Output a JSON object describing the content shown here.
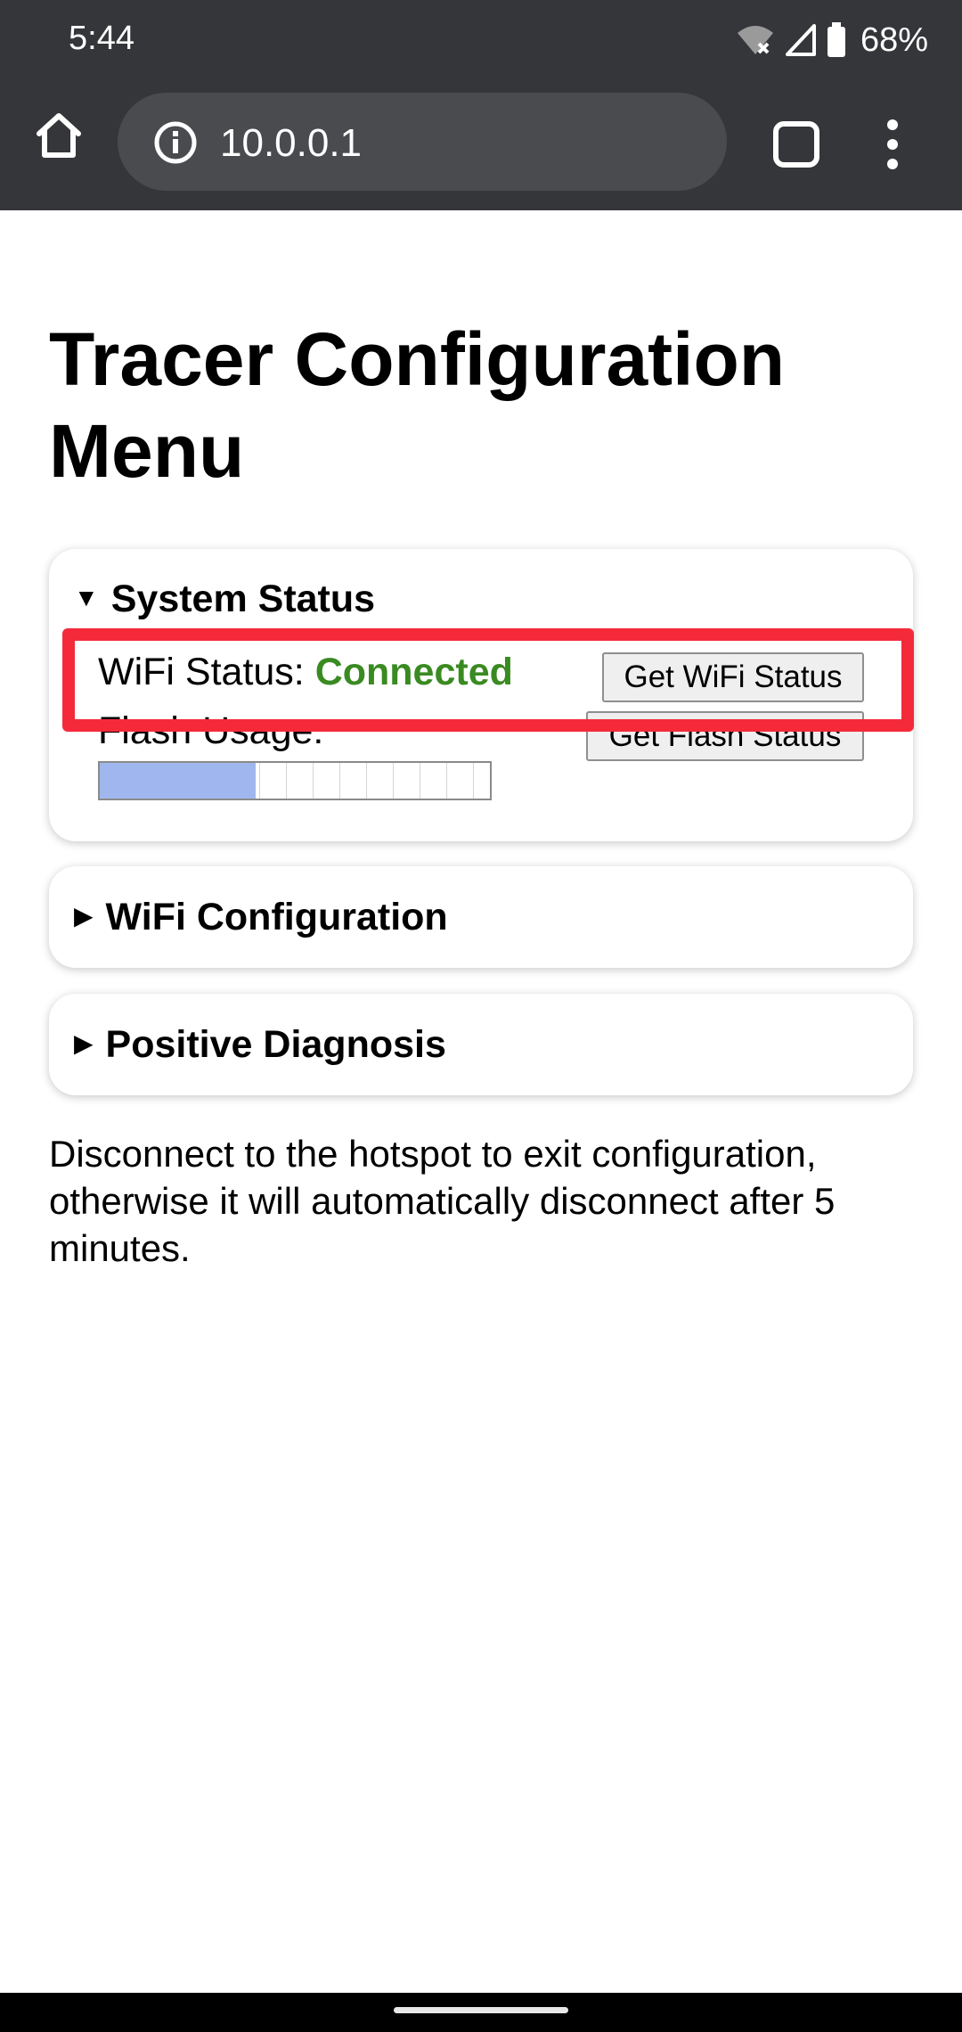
{
  "status_bar": {
    "time": "5:44",
    "battery": "68%",
    "icons": [
      "wifi-no-internet-icon",
      "cell-signal-icon",
      "battery-icon"
    ]
  },
  "browser": {
    "url": "10.0.0.1",
    "icons": [
      "home-icon",
      "info-icon",
      "tabs-icon",
      "overflow-menu-icon"
    ]
  },
  "page": {
    "title": "Tracer Configuration Menu",
    "sections": {
      "system_status": {
        "label": "System Status",
        "expanded": true,
        "wifi_label": "WiFi Status: ",
        "wifi_value": "Connected",
        "wifi_button": "Get WiFi Status",
        "flash_label": "Flash Usage:",
        "flash_button": "Get Flash Status",
        "flash_usage_fraction": 0.4
      },
      "wifi_configuration": {
        "label": "WiFi Configuration",
        "expanded": false
      },
      "positive_diagnosis": {
        "label": "Positive Diagnosis",
        "expanded": false
      }
    },
    "footer_note": "Disconnect to the hotspot to exit configuration, otherwise it will automatically disconnect after 5 minutes."
  },
  "colors": {
    "chrome_bar": "#35363a",
    "url_pill": "#4a4b4f",
    "connected": "#3a8a22",
    "highlight": "#f42a3a",
    "progress_fill": "#9fb7ee"
  }
}
